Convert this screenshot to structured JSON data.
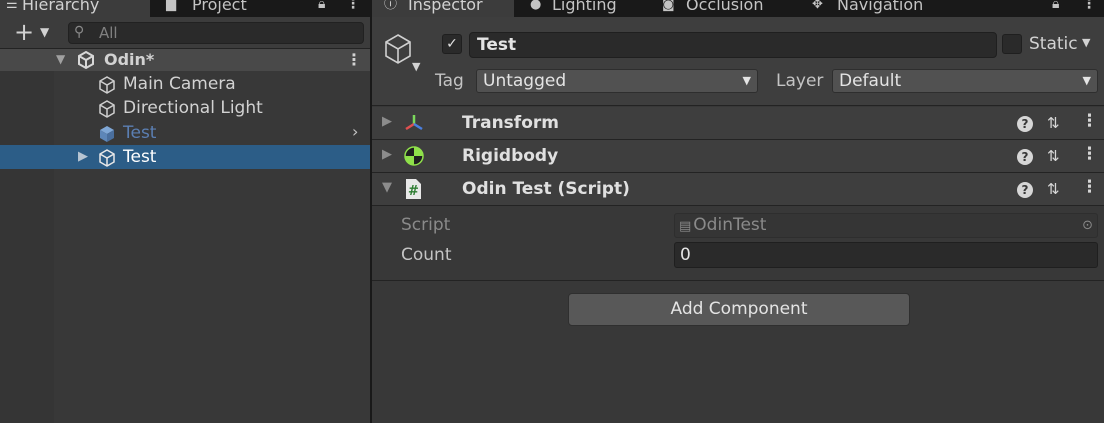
{
  "hierarchy": {
    "tab_label": "Hierarchy",
    "project_tab_label": "Project",
    "search_placeholder": "All",
    "scene": {
      "name": "Odin*"
    },
    "items": [
      {
        "label": "Main Camera"
      },
      {
        "label": "Directional Light"
      },
      {
        "label": "Test",
        "prefab": true
      },
      {
        "label": "Test",
        "selected": true
      }
    ]
  },
  "inspector": {
    "tabs": [
      {
        "label": "Inspector"
      },
      {
        "label": "Lighting"
      },
      {
        "label": "Occlusion"
      },
      {
        "label": "Navigation"
      }
    ],
    "game_object": {
      "active": true,
      "name": "Test",
      "static_label": "Static",
      "static": false,
      "tag_label": "Tag",
      "tag_value": "Untagged",
      "layer_label": "Layer",
      "layer_value": "Default"
    },
    "components": [
      {
        "title": "Transform",
        "icon": "transform-icon",
        "expanded": false
      },
      {
        "title": "Rigidbody",
        "icon": "rigidbody-icon",
        "expanded": false
      },
      {
        "title": "Odin Test (Script)",
        "icon": "script-icon",
        "expanded": true
      }
    ],
    "odin_test": {
      "script_label": "Script",
      "script_value": "OdinTest",
      "count_label": "Count",
      "count_value": "0"
    },
    "add_component_label": "Add Component"
  },
  "colors": {
    "selection": "#2c5d87",
    "prefab_text": "#5b7fb3",
    "panel_bg": "#383838",
    "header_bg": "#3e3e3e"
  }
}
